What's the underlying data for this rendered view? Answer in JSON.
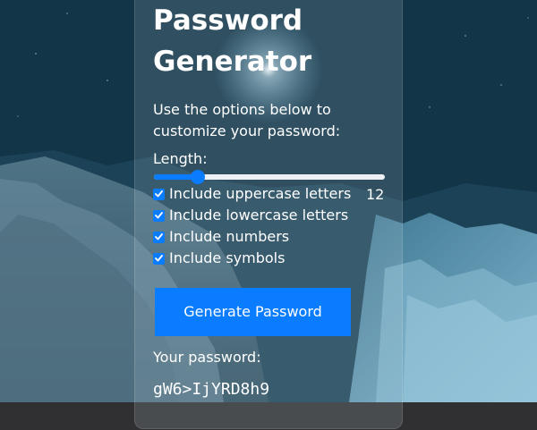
{
  "generator": {
    "title": "Password Generator",
    "description": "Use the options below to customize your password:",
    "length_label": "Length:",
    "length": {
      "value": 12,
      "fraction": 0.19
    },
    "options": [
      {
        "label": "Include uppercase letters",
        "checked": true
      },
      {
        "label": "Include lowercase letters",
        "checked": true
      },
      {
        "label": "Include numbers",
        "checked": true
      },
      {
        "label": "Include symbols",
        "checked": true
      }
    ],
    "button_label": "Generate Password",
    "result_label": "Your password:",
    "password": "gW6>IjYRD8h9"
  },
  "colors": {
    "accent": "#0a7cff",
    "text": "#ffffff",
    "bottom_bar": "#303032"
  },
  "icons": {
    "checkbox_checked": "checkmark-icon"
  }
}
